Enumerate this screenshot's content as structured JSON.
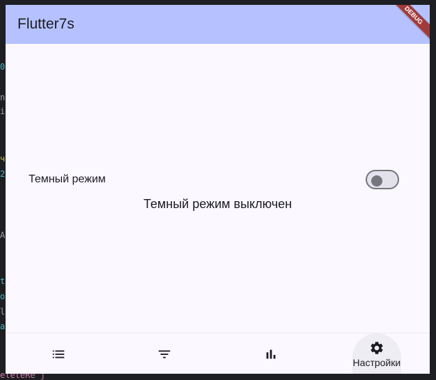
{
  "app": {
    "title": "Flutter7s",
    "debug_banner": "DEBUG"
  },
  "settings": {
    "dark_mode_label": "Темный режим",
    "dark_mode_enabled": false,
    "status_text": "Темный режим выключен"
  },
  "bottom_nav": {
    "items": [
      {
        "icon": "list-icon",
        "label": ""
      },
      {
        "icon": "filter-icon",
        "label": ""
      },
      {
        "icon": "bar-chart-icon",
        "label": ""
      },
      {
        "icon": "settings-icon",
        "label": "Настройки",
        "active": true
      }
    ]
  },
  "ide_background": {
    "fragments": [
      "0",
      "n",
      "i",
      "ч",
      "2",
      "A",
      "t",
      "o",
      "l",
      "a",
      "eleteRe j"
    ]
  },
  "colors": {
    "app_bar": "#b6c2ff",
    "surface": "#fbf8ff",
    "debug_banner": "#a23a3a"
  }
}
